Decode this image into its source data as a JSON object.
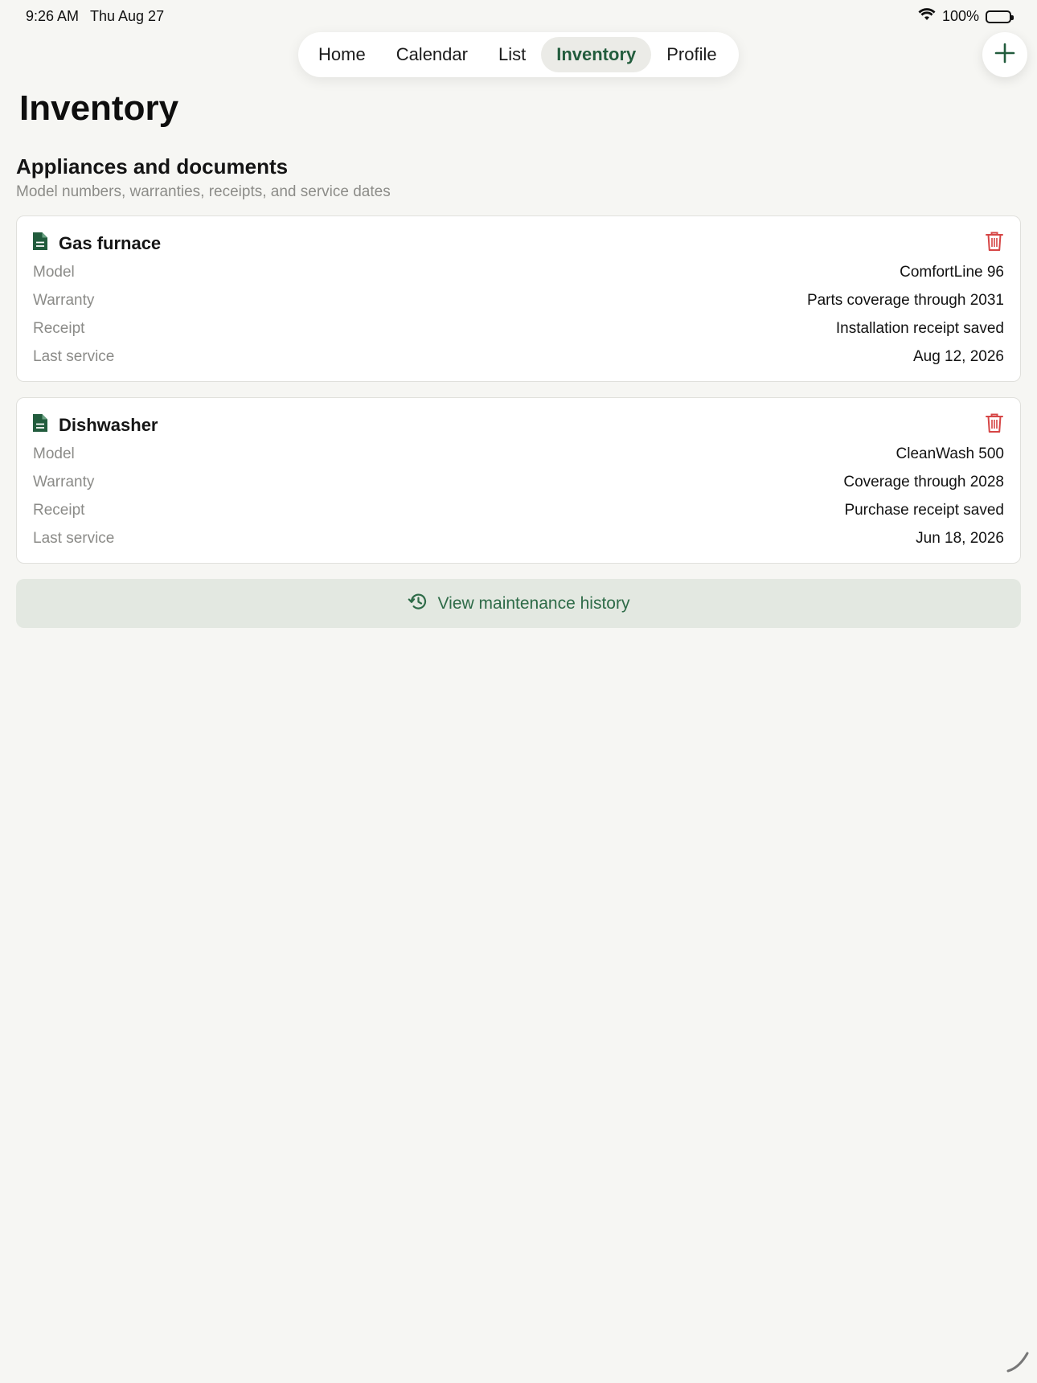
{
  "status_bar": {
    "time": "9:26 AM",
    "date": "Thu Aug 27",
    "battery": "100%"
  },
  "nav": {
    "tabs": [
      {
        "label": "Home",
        "active": false
      },
      {
        "label": "Calendar",
        "active": false
      },
      {
        "label": "List",
        "active": false
      },
      {
        "label": "Inventory",
        "active": true
      },
      {
        "label": "Profile",
        "active": false
      }
    ]
  },
  "page": {
    "title": "Inventory"
  },
  "section": {
    "title": "Appliances and documents",
    "subtitle": "Model numbers, warranties, receipts, and service dates"
  },
  "items": [
    {
      "name": "Gas furnace",
      "fields": [
        {
          "label": "Model",
          "value": "ComfortLine 96"
        },
        {
          "label": "Warranty",
          "value": "Parts coverage through 2031"
        },
        {
          "label": "Receipt",
          "value": "Installation receipt saved"
        },
        {
          "label": "Last service",
          "value": "Aug 12, 2026"
        }
      ]
    },
    {
      "name": "Dishwasher",
      "fields": [
        {
          "label": "Model",
          "value": "CleanWash 500"
        },
        {
          "label": "Warranty",
          "value": "Coverage through 2028"
        },
        {
          "label": "Receipt",
          "value": "Purchase receipt saved"
        },
        {
          "label": "Last service",
          "value": "Jun 18, 2026"
        }
      ]
    }
  ],
  "history_button": {
    "label": "View maintenance history"
  },
  "icons": {
    "document": "document-icon",
    "delete": "trash-icon",
    "add": "plus-icon",
    "history": "history-icon",
    "wifi": "wifi-icon"
  },
  "colors": {
    "accent": "#225c3d",
    "delete": "#d64545",
    "background": "#f6f6f3",
    "history_bg": "#e3e8e1"
  }
}
